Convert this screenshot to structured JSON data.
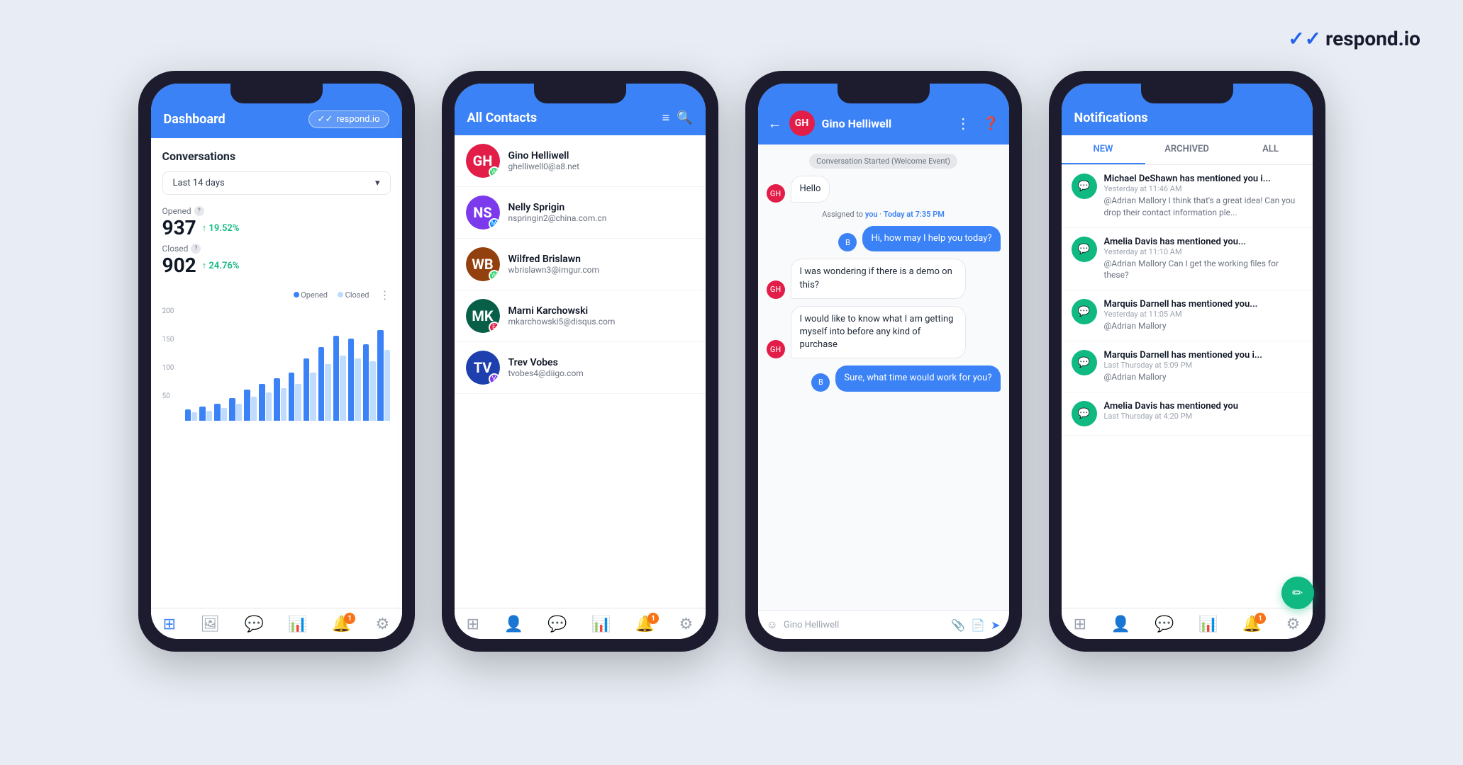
{
  "brand": {
    "name": "respond.io",
    "checkmark": "✓✓"
  },
  "phone1": {
    "header_title": "Dashboard",
    "logo_label": "respond.io",
    "section_title": "Conversations",
    "dropdown_label": "Last 14 days",
    "opened_label": "Opened",
    "opened_value": "937",
    "opened_change": "↑ 19.52%",
    "closed_label": "Closed",
    "closed_value": "902",
    "closed_change": "↑ 24.76%",
    "legend_opened": "Opened",
    "legend_closed": "Closed",
    "chart_y": [
      "200",
      "150",
      "100",
      "50"
    ],
    "bar_data": [
      {
        "h1": 20,
        "h2": 15
      },
      {
        "h1": 25,
        "h2": 18
      },
      {
        "h1": 30,
        "h2": 22
      },
      {
        "h1": 40,
        "h2": 30
      },
      {
        "h1": 55,
        "h2": 42
      },
      {
        "h1": 65,
        "h2": 50
      },
      {
        "h1": 75,
        "h2": 58
      },
      {
        "h1": 85,
        "h2": 65
      },
      {
        "h1": 110,
        "h2": 85
      },
      {
        "h1": 130,
        "h2": 100
      },
      {
        "h1": 150,
        "h2": 115
      },
      {
        "h1": 145,
        "h2": 110
      },
      {
        "h1": 135,
        "h2": 105
      },
      {
        "h1": 160,
        "h2": 125
      }
    ],
    "nav": [
      "⊞",
      "🖼",
      "💬",
      "📊",
      "🔔",
      "⚙"
    ]
  },
  "phone2": {
    "header_title": "All Contacts",
    "contacts": [
      {
        "name": "Gino Helliwell",
        "email": "ghelliwell0@a8.net",
        "color": "#e11d48",
        "badge_color": "#25d366",
        "badge": "W",
        "initials": "GH"
      },
      {
        "name": "Nelly Sprigin",
        "email": "nspringin2@china.com.cn",
        "color": "#7c3aed",
        "badge_color": "#0084ff",
        "badge": "M",
        "initials": "NS"
      },
      {
        "name": "Wilfred Brislawn",
        "email": "wbrislawn3@imgur.com",
        "color": "#92400e",
        "badge_color": "#25d366",
        "badge": "W",
        "initials": "WB"
      },
      {
        "name": "Marni Karchowski",
        "email": "mkarchowski5@disqus.com",
        "color": "#065f46",
        "badge_color": "#e11d48",
        "badge": "E",
        "initials": "MK"
      },
      {
        "name": "Trev Vobes",
        "email": "tvobes4@diigo.com",
        "color": "#1e40af",
        "badge_color": "#7c3aed",
        "badge": "V",
        "initials": "TV"
      }
    ]
  },
  "phone3": {
    "contact_name": "Gino Helliwell",
    "system_msg": "Conversation Started (Welcome Event)",
    "hello_msg": "Hello",
    "assigned_msg": "Assigned to",
    "assigned_to": "you",
    "assigned_time": "Today at 7:35 PM",
    "bot_msg": "Hi, how may I help you today?",
    "user_msg1": "I was wondering if there is a demo on this?",
    "user_msg2": "I would like to know what I am getting myself into before any kind of purchase",
    "bot_msg2": "Sure, what time would work for you?",
    "input_placeholder": "Gino Helliwell"
  },
  "phone4": {
    "header_title": "Notifications",
    "tabs": [
      "NEW",
      "ARCHIVED",
      "ALL"
    ],
    "active_tab": 0,
    "notifications": [
      {
        "title": "Michael DeShawn has mentioned you i...",
        "time": "Yesterday at 11:46 AM",
        "body": "@Adrian Mallory I think that's a great idea! Can you drop their contact information ple..."
      },
      {
        "title": "Amelia Davis has mentioned you...",
        "time": "Yesterday at 11:10 AM",
        "body": "@Adrian Mallory Can I get the working files for these?"
      },
      {
        "title": "Marquis Darnell has mentioned you...",
        "time": "Yesterday at 11:05 AM",
        "body": "@Adrian Mallory"
      },
      {
        "title": "Marquis Darnell has mentioned you i...",
        "time": "Last Thursday at 5:09 PM",
        "body": "@Adrian Mallory"
      },
      {
        "title": "Amelia Davis has mentioned you",
        "time": "Last Thursday at 4:20 PM",
        "body": ""
      }
    ]
  }
}
